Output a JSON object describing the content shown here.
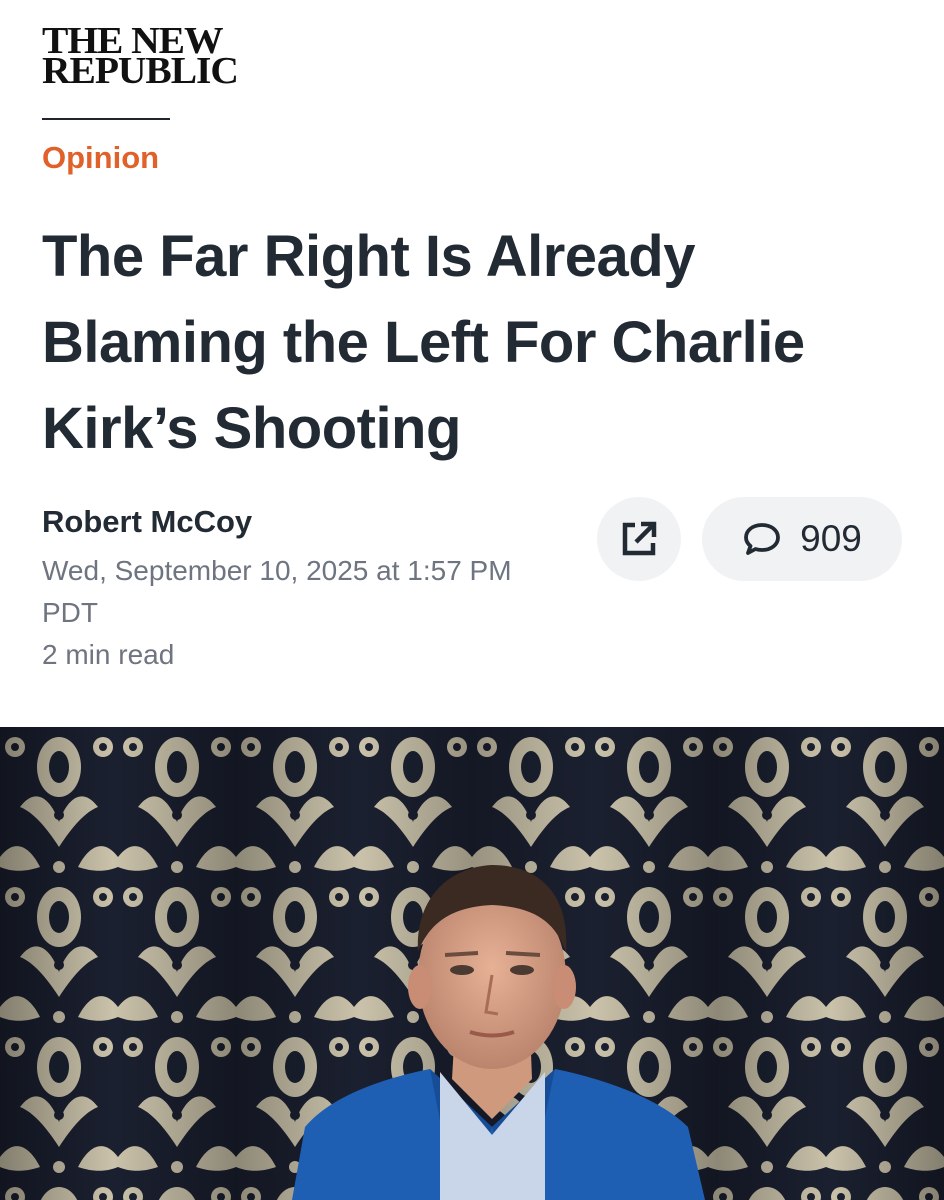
{
  "brand": {
    "line1": "THE NEW",
    "line2": "REPUBLIC"
  },
  "article": {
    "section": "Opinion",
    "headline": "The Far Right Is Already Blaming the Left For Charlie Kirk’s Shooting",
    "author": "Robert McCoy",
    "datetime": "Wed, September 10, 2025 at 1:57 PM PDT",
    "read_time": "2 min read"
  },
  "actions": {
    "share_icon": "share-external-icon",
    "comment_icon": "speech-bubble-icon",
    "comment_count": "909"
  },
  "hero": {
    "description_icon": "photo"
  },
  "colors": {
    "accent": "#e0612a",
    "text": "#222a34",
    "muted": "#6e7480",
    "button_bg": "#f1f2f4"
  }
}
